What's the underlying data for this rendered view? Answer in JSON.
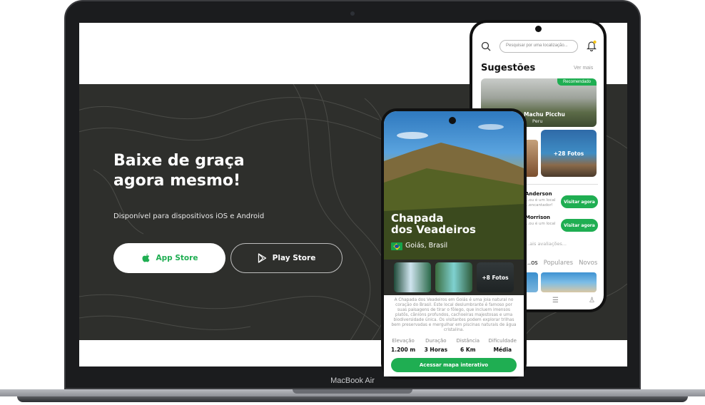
{
  "laptop": {
    "model_label": "MacBook Air"
  },
  "hero": {
    "title": "Baixe de graça\nagora mesmo!",
    "subtitle": "Disponível para dispositivos iOS e Android",
    "app_store_label": "App Store",
    "play_store_label": "Play Store"
  },
  "back_phone": {
    "search_placeholder": "Pesquisar por uma localização...",
    "section_title": "Sugestões",
    "see_more": "Ver mais",
    "featured": {
      "badge": "Recomendado",
      "name": "Machu Picchu",
      "country": "Peru"
    },
    "photos_badge": "+28 Fotos",
    "guides": [
      {
        "name": "Anderson",
        "desc_1": "...ou é um local",
        "desc_2": "...encantador!",
        "button": "Visitar agora"
      },
      {
        "name": "Morrison",
        "desc_1": "...ou é um local",
        "desc_2": "",
        "button": "Visitar agora"
      }
    ],
    "reviews": "...ais avaliações...",
    "tabs": [
      "...os",
      "Populares",
      "Novos"
    ]
  },
  "front_phone": {
    "place_title": "Chapada\ndos Veadeiros",
    "location": "Goiás, Brasil",
    "photos_badge": "+8 Fotos",
    "description": "A Chapada dos Veadeiros em Goiás é uma joia natural no coração do Brasil. Este local deslumbrante é famoso por suas paisagens de tirar o fôlego, que incluem imensos platôs, cânions profundos, cachoeiras majestosas e uma biodiversidade única. Os visitantes podem explorar trilhas bem preservadas e mergulhar em piscinas naturais de água cristalina.",
    "stats": [
      {
        "label": "Elevação",
        "value": "1.200 m"
      },
      {
        "label": "Duração",
        "value": "3 Horas"
      },
      {
        "label": "Distância",
        "value": "6 Km"
      },
      {
        "label": "Dificuldade",
        "value": "Média"
      }
    ],
    "map_button": "Acessar mapa interativo"
  },
  "colors": {
    "accent": "#1fae52",
    "hero_bg": "#2e2f2c"
  },
  "icons": [
    "apple-icon",
    "play-store-icon",
    "search-icon",
    "bell-icon",
    "menu-icon",
    "user-icon"
  ]
}
